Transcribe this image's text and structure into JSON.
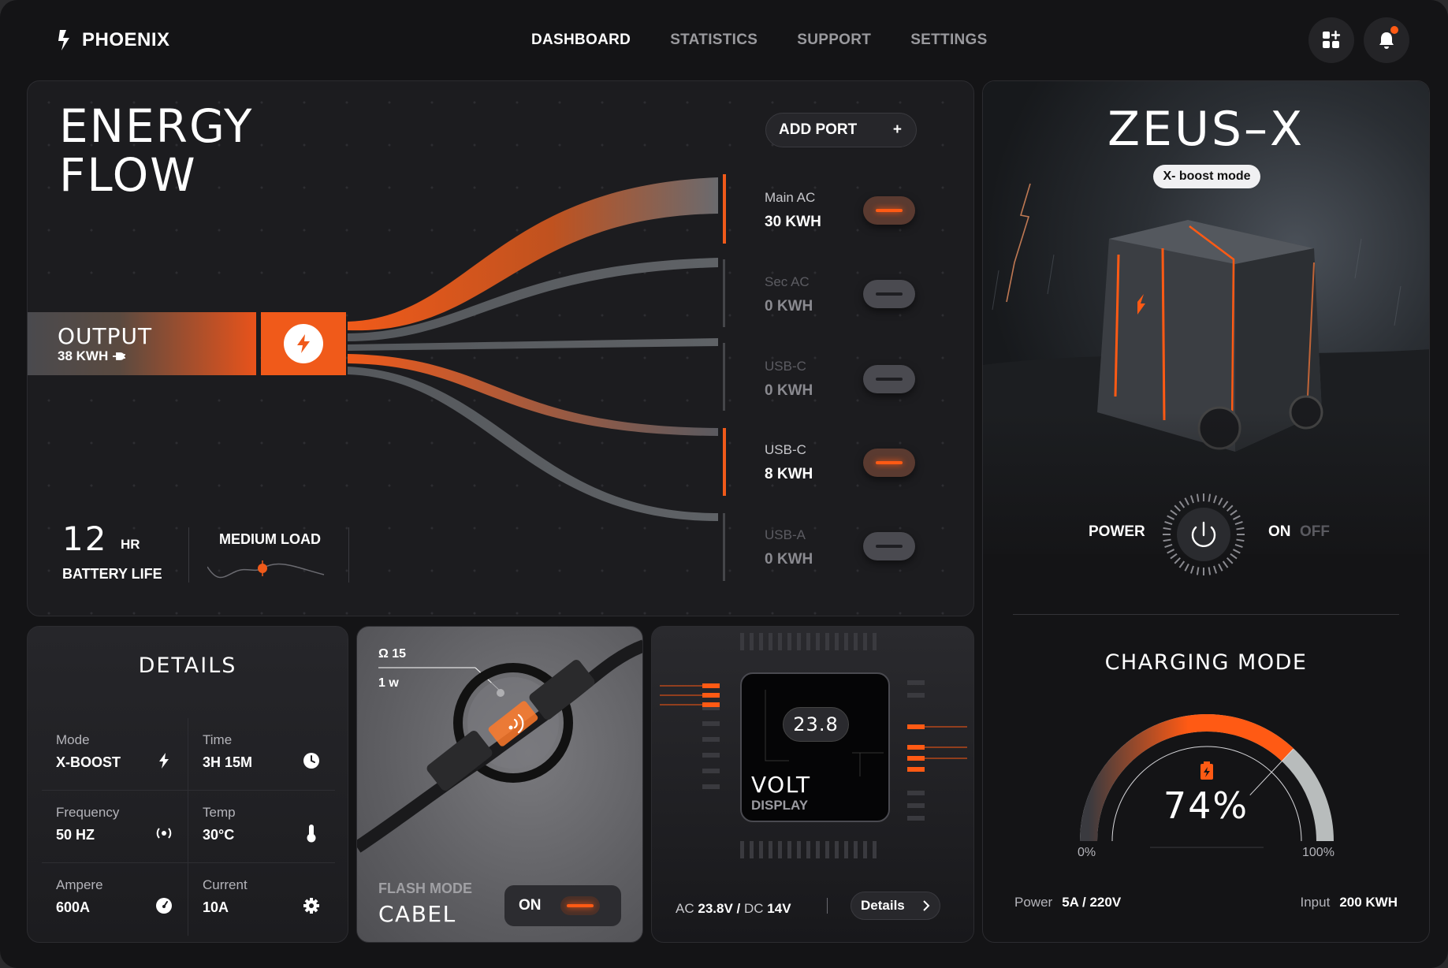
{
  "header": {
    "brand": "PHOENIX",
    "nav": [
      "DASHBOARD",
      "STATISTICS",
      "SUPPORT",
      "SETTINGS"
    ],
    "active_nav": "DASHBOARD",
    "icons": [
      "apps-add-icon",
      "bell-icon"
    ]
  },
  "energy_flow": {
    "title_line1": "ENERGY",
    "title_line2": "FLOW",
    "add_port": "ADD PORT",
    "add_port_icon": "+",
    "output": {
      "label": "OUTPUT",
      "value": "38 KWH"
    },
    "ports": [
      {
        "name": "Main AC",
        "value": "30 KWH",
        "on": true
      },
      {
        "name": "Sec AC",
        "value": "0 KWH",
        "on": false
      },
      {
        "name": "USB-C",
        "value": "0 KWH",
        "on": false
      },
      {
        "name": "USB-C",
        "value": "8 KWH",
        "on": true
      },
      {
        "name": "USB-A",
        "value": "0 KWH",
        "on": false
      }
    ],
    "battery_life": {
      "value": "12",
      "unit": "HR",
      "label": "BATTERY LIFE"
    },
    "load": "MEDIUM LOAD"
  },
  "details": {
    "title": "DETAILS",
    "items": [
      {
        "key": "Mode",
        "value": "X-BOOST",
        "icon": "bolt-icon"
      },
      {
        "key": "Time",
        "value": "3H 15M",
        "icon": "clock-icon"
      },
      {
        "key": "Frequency",
        "value": "50 HZ",
        "icon": "signal-icon"
      },
      {
        "key": "Temp",
        "value": "30°C",
        "icon": "thermometer-icon"
      },
      {
        "key": "Ampere",
        "value": "600A",
        "icon": "gauge-icon"
      },
      {
        "key": "Current",
        "value": "10A",
        "icon": "gear-icon"
      }
    ]
  },
  "cable": {
    "ohm": "Ω 15",
    "watt": "1 w",
    "mode_label": "FLASH MODE",
    "title": "CABEL",
    "toggle": "ON"
  },
  "volt": {
    "value": "23.8",
    "title": "VOLT",
    "subtitle": "DISPLAY",
    "ac_label": "AC",
    "ac_value": "23.8V",
    "dc_label": "DC",
    "dc_value": "14V",
    "slash": "/",
    "details_button": "Details"
  },
  "zeus": {
    "title": "ZEUS–X",
    "badge": "X- boost mode",
    "power_label": "POWER",
    "on_label": "ON",
    "off_label": "OFF",
    "charging_title": "CHARGING MODE",
    "charge_percent": "74%",
    "charge_fraction": 0.74,
    "gauge_min": "0%",
    "gauge_max": "100%",
    "power_key": "Power",
    "power_value": "5A / 220V",
    "input_key": "Input",
    "input_value": "200 KWH"
  },
  "colors": {
    "accent": "#ff5a14",
    "background": "#141416",
    "panel": "#1c1c1f"
  }
}
